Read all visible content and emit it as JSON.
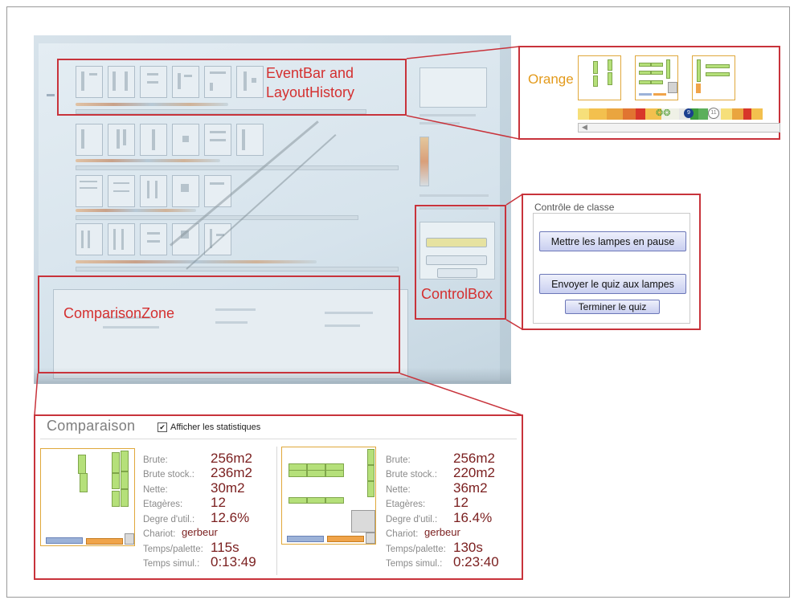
{
  "callouts": {
    "eventbar_label": "EventBar and LayoutHistory",
    "controlbox_label": "ControlBox",
    "comparisonzone_label": "ComparisonZone"
  },
  "colors": {
    "annotation_red": "#c8333b",
    "orange_team": "#e39a1b",
    "shelf_green": "#b5e07a",
    "stat_value": "#7a1e1e"
  },
  "orange_detail": {
    "team_label": "Orange",
    "event_circles": [
      "9",
      "11"
    ]
  },
  "control_box": {
    "title": "Contrôle de classe",
    "pause_button": "Mettre les lampes en pause",
    "send_quiz_button": "Envoyer le quiz aux lampes",
    "end_quiz_button": "Terminer le quiz"
  },
  "comparison": {
    "title": "Comparaison",
    "checkbox_label": "Afficher les statistiques",
    "checkbox_checked": true,
    "stat_labels": [
      "Brute:",
      "Brute stock.:",
      "Nette:",
      "Etagères:",
      "Degre d'util.:",
      "Chariot:",
      "Temps/palette:",
      "Temps simul.:"
    ],
    "left": {
      "brute": "256m2",
      "brute_stock": "236m2",
      "nette": "30m2",
      "etageres": "12",
      "degre": "12.6%",
      "chariot": "gerbeur",
      "temps_palette": "115s",
      "temps_simul": "0:13:49"
    },
    "right": {
      "brute": "256m2",
      "brute_stock": "220m2",
      "nette": "36m2",
      "etageres": "12",
      "degre": "16.4%",
      "chariot": "gerbeur",
      "temps_palette": "130s",
      "temps_simul": "0:23:40"
    }
  }
}
